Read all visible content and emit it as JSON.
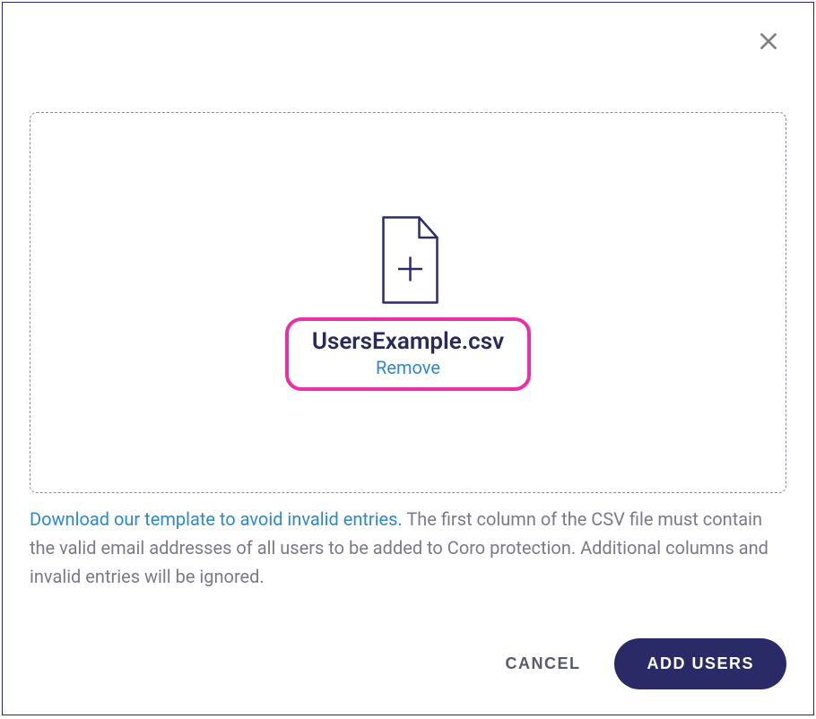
{
  "close_label": "Close",
  "dropzone": {
    "file_name": "UsersExample.csv",
    "remove_label": "Remove"
  },
  "help": {
    "template_link": "Download our template to avoid invalid entries.",
    "description": " The first column of the CSV file must contain the valid email addresses of all users to be added to Coro protection. Additional columns and invalid entries will be ignored."
  },
  "actions": {
    "cancel_label": "CANCEL",
    "add_users_label": "ADD USERS"
  }
}
